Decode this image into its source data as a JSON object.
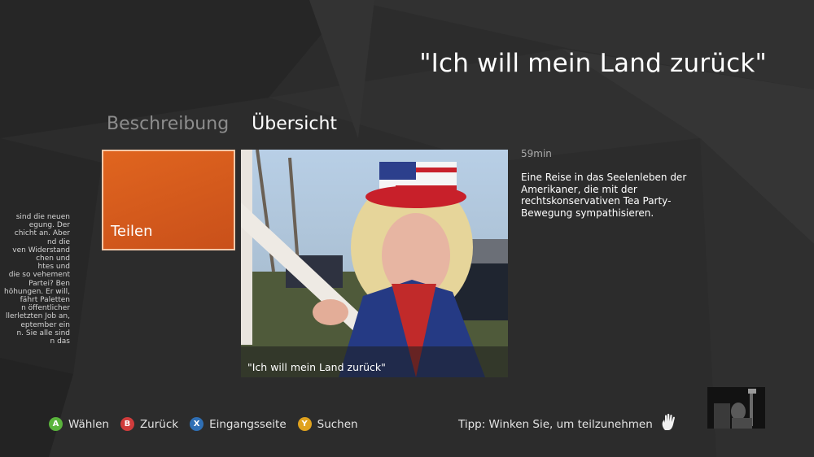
{
  "header": {
    "title": "\"Ich will mein Land zurück\""
  },
  "tabs": [
    {
      "label": "Beschreibung",
      "active": false
    },
    {
      "label": "Übersicht",
      "active": true
    }
  ],
  "previous_panel": {
    "lines": [
      "sind die neuen",
      "egung. Der",
      "chicht an. Aber",
      "nd die",
      "ven Widerstand",
      "chen und",
      "htes und",
      "die so vehement",
      "Partei? Ben",
      "höhungen. Er will,",
      "fährt Paletten",
      "n öffentlicher",
      "llerletzten Job an,",
      "eptember ein",
      "n. Sie alle sind",
      "n das"
    ]
  },
  "share_tile": {
    "label": "Teilen",
    "color": "#d85a1c"
  },
  "episode": {
    "caption": "\"Ich will mein Land zurück\"",
    "duration": "59min",
    "description": "Eine Reise in das Seelenleben der Amerikaner, die mit der rechtskonservativen Tea Party-Bewegung sympathisieren."
  },
  "footer": {
    "buttons": [
      {
        "key": "A",
        "label": "Wählen",
        "color": "#5ab43c"
      },
      {
        "key": "B",
        "label": "Zurück",
        "color": "#d03c3c"
      },
      {
        "key": "X",
        "label": "Eingangsseite",
        "color": "#2f6fb5"
      },
      {
        "key": "Y",
        "label": "Suchen",
        "color": "#e0a21e"
      }
    ],
    "tip": "Tipp: Winken Sie, um teilzunehmen",
    "hand_icon": "hand-wave-icon"
  }
}
